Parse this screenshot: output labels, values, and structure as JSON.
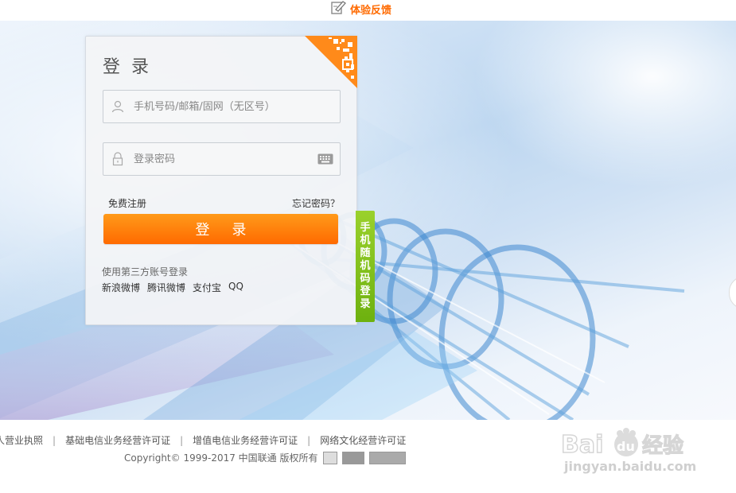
{
  "topbar": {
    "feedback_label": "体验反馈",
    "feedback_icon": "edit-note-icon"
  },
  "login": {
    "title": "登录",
    "account_placeholder": "手机号码/邮箱/固网（无区号）",
    "password_placeholder": "登录密码",
    "register_label": "免费注册",
    "forgot_label": "忘记密码？",
    "submit_label": "登录",
    "third_party_label": "使用第三方账号登录",
    "third_party": [
      "新浪微博",
      "腾讯微博",
      "支付宝",
      "QQ"
    ],
    "sms_login_tab": "手机随机码登录"
  },
  "footer": {
    "links": [
      "人营业执照",
      "基础电信业务经营许可证",
      "增值电信业务经营许可证",
      "网络文化经营许可证"
    ],
    "copyright": "Copyright© 1999-2017 中国联通 版权所有"
  },
  "watermark": {
    "logo": "Bai du 经验",
    "url": "jingyan.baidu.com"
  },
  "colors": {
    "accent": "#ff6a00",
    "sms_tab": "#7cc11a",
    "qr": "#ff8a1a"
  }
}
